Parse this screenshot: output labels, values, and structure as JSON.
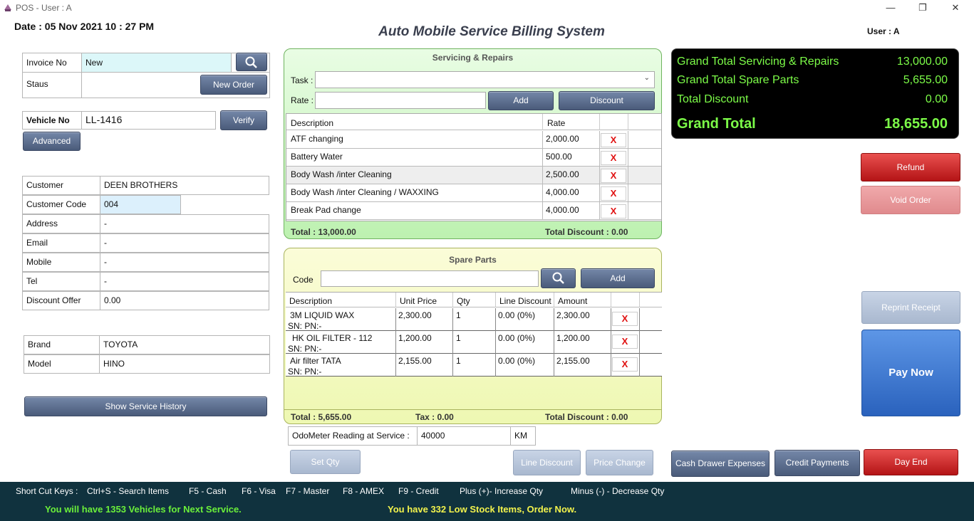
{
  "window": {
    "title": "POS -  User : A"
  },
  "header": {
    "date": "Date : 05 Nov 2021  10 : 27 PM",
    "title": "Auto Mobile Service Billing System",
    "user": "User : A"
  },
  "invoice": {
    "invoice_label": "Invoice No",
    "invoice_value": "New",
    "status_label": "Staus",
    "new_order": "New Order"
  },
  "vehicle": {
    "label": "Vehicle No",
    "value": "LL-1416",
    "verify": "Verify",
    "advanced": "Advanced"
  },
  "customer": {
    "rows": [
      {
        "label": "Customer",
        "value": "DEEN BROTHERS"
      },
      {
        "label": "Customer Code",
        "value": "004"
      },
      {
        "label": "Address",
        "value": "-"
      },
      {
        "label": "Email",
        "value": "-"
      },
      {
        "label": "Mobile",
        "value": "-"
      },
      {
        "label": "Tel",
        "value": "-"
      },
      {
        "label": "Discount Offer",
        "value": "0.00"
      }
    ]
  },
  "car": {
    "rows": [
      {
        "label": "Brand",
        "value": "TOYOTA"
      },
      {
        "label": "Model",
        "value": "HINO"
      }
    ]
  },
  "history_button": "Show Service History",
  "servicing": {
    "title": "Servicing & Repairs",
    "task_label": "Task :",
    "task_value": "",
    "rate_label": "Rate :",
    "rate_value": "",
    "add": "Add",
    "discount": "Discount",
    "columns": [
      "Description",
      "Rate"
    ],
    "rows": [
      {
        "desc": "ATF changing",
        "rate": "2,000.00"
      },
      {
        "desc": "Battery Water",
        "rate": "500.00"
      },
      {
        "desc": "Body Wash /inter Cleaning",
        "rate": "2,500.00"
      },
      {
        "desc": "Body Wash /inter Cleaning / WAXXING",
        "rate": "4,000.00"
      },
      {
        "desc": "Break Pad change",
        "rate": "4,000.00"
      }
    ],
    "remove": "X",
    "total": "Total : 13,000.00",
    "total_discount": "Total Discount : 0.00"
  },
  "parts": {
    "title": "Spare Parts",
    "code_label": "Code",
    "code_value": "",
    "add": "Add",
    "columns": [
      "Description",
      "Unit Price",
      "Qty",
      "Line Discount",
      "Amount"
    ],
    "rows": [
      {
        "desc": "3M  LIQUID WAX",
        "sn": "SN: PN:-",
        "unit": "2,300.00",
        "qty": "1",
        "disc": "0.00 (0%)",
        "amount": "2,300.00"
      },
      {
        "desc": "HK  OIL FILTER - 112",
        "sn": "SN: PN:-",
        "unit": "1,200.00",
        "qty": "1",
        "disc": "0.00 (0%)",
        "amount": "1,200.00"
      },
      {
        "desc": "Air filter  TATA",
        "sn": "SN: PN:-",
        "unit": "2,155.00",
        "qty": "1",
        "disc": "0.00 (0%)",
        "amount": "2,155.00"
      }
    ],
    "remove": "X",
    "total": "Total : 5,655.00",
    "tax": "Tax : 0.00",
    "total_discount": "Total Discount : 0.00"
  },
  "odometer": {
    "label": "OdoMeter Reading at Service :",
    "value": "40000",
    "unit": "KM"
  },
  "bottom_buttons": {
    "set_qty": "Set Qty",
    "line_discount": "Line Discount",
    "price_change": "Price Change"
  },
  "totals": {
    "servicing_label": "Grand Total Servicing & Repairs",
    "servicing_value": "13,000.00",
    "parts_label": "Grand Total Spare Parts",
    "parts_value": "5,655.00",
    "discount_label": "Total Discount",
    "discount_value": "0.00",
    "grand_label": "Grand Total",
    "grand_value": "18,655.00"
  },
  "actions": {
    "refund": "Refund",
    "void": "Void Order",
    "reprint": "Reprint Receipt",
    "pay": "Pay Now",
    "cash_drawer": "Cash Drawer Expenses",
    "credit": "Credit Payments",
    "day_end": "Day End"
  },
  "footer": {
    "shortcuts": [
      "Short Cut Keys :",
      "Ctrl+S - Search Items",
      "F5 - Cash",
      "F6 - Visa",
      "F7 - Master",
      "F8 - AMEX",
      "F9 - Credit",
      "Plus (+)- Increase Qty",
      "Minus (-) - Decrease Qty"
    ],
    "msg_vehicles": "You will have 1353 Vehicles for Next Service.",
    "msg_stock": "You have 332 Low Stock Items, Order Now."
  },
  "colors": {
    "accent_green": "#7cfc48",
    "panel_green": "#bdf1b0",
    "panel_yellow": "#eef8b2",
    "footer_bg": "#10323e",
    "danger": "#b41416",
    "primary": "#2a62bd"
  }
}
